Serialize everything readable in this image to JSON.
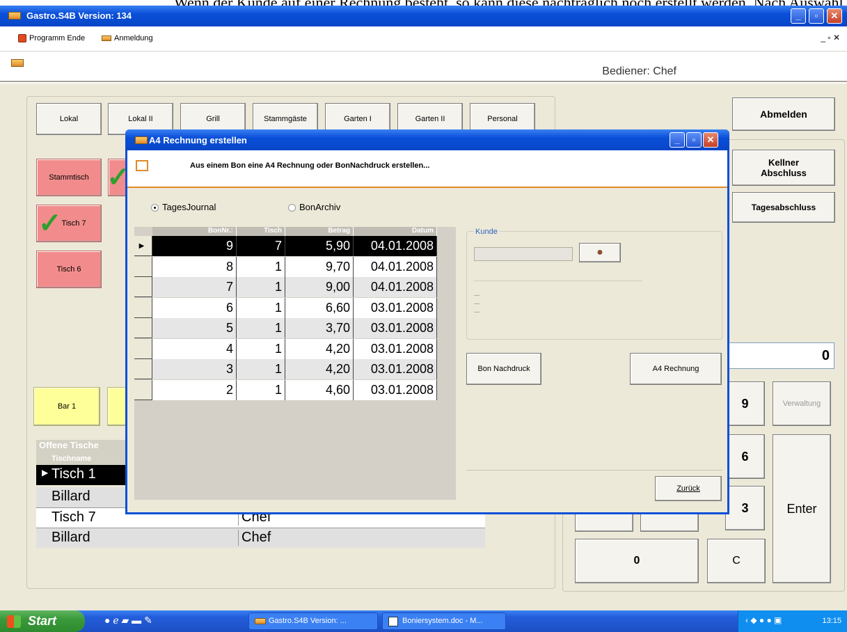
{
  "top_caption": "Wenn der Kunde auf einer Rechnung besteht, so kann diese nachträglich noch erstellt werden. Nach Auswahl des Bons über",
  "window": {
    "title": "Gastro.S4B Version:  134"
  },
  "menu": {
    "items": [
      "Programm Ende",
      "Anmeldung"
    ]
  },
  "header": {
    "bediener": "Bediener: Chef"
  },
  "room_tabs": [
    "Lokal",
    "Lokal II",
    "Grill",
    "Stammgäste",
    "Garten I",
    "Garten II",
    "Personal"
  ],
  "tables": {
    "stammtisch": "Stammtisch",
    "tisch7": "Tisch 7",
    "tisch6": "Tisch 6",
    "bar1": "Bar 1"
  },
  "right_buttons": {
    "abmelden": "Abmelden",
    "kellner": "Kellner Abschluss",
    "tages": "Tagesabschluss"
  },
  "open_tables": {
    "title": "Offene Tische",
    "col": "Tischname",
    "rows": [
      {
        "name": "Tisch  1",
        "waiter": ""
      },
      {
        "name": "Billard",
        "waiter": ""
      },
      {
        "name": "Tisch 7",
        "waiter": "Chef"
      },
      {
        "name": "Billard",
        "waiter": "Chef"
      }
    ]
  },
  "numpad": {
    "display": "0",
    "k9": "9",
    "k6": "6",
    "k3": "3",
    "k0": "0",
    "kc": "C",
    "enter": "Enter",
    "verwaltung": "Verwaltung"
  },
  "dialog": {
    "title": "A4 Rechnung erstellen",
    "subtitle": "Aus einem Bon eine A4 Rechnung oder BonNachdruck erstellen...",
    "radio_journal": "TagesJournal",
    "radio_archiv": "BonArchiv",
    "columns": [
      "BonNr.:",
      "Tisch",
      "Betrag",
      "Datum"
    ],
    "rows": [
      {
        "bon": "9",
        "tisch": "7",
        "betrag": "5,90",
        "datum": "04.01.2008"
      },
      {
        "bon": "8",
        "tisch": "1",
        "betrag": "9,70",
        "datum": "04.01.2008"
      },
      {
        "bon": "7",
        "tisch": "1",
        "betrag": "9,00",
        "datum": "04.01.2008"
      },
      {
        "bon": "6",
        "tisch": "1",
        "betrag": "6,60",
        "datum": "03.01.2008"
      },
      {
        "bon": "5",
        "tisch": "1",
        "betrag": "3,70",
        "datum": "03.01.2008"
      },
      {
        "bon": "4",
        "tisch": "1",
        "betrag": "4,20",
        "datum": "03.01.2008"
      },
      {
        "bon": "3",
        "tisch": "1",
        "betrag": "4,20",
        "datum": "03.01.2008"
      },
      {
        "bon": "2",
        "tisch": "1",
        "betrag": "4,60",
        "datum": "03.01.2008"
      }
    ],
    "kunde_label": "Kunde",
    "dots": [
      "...",
      "...",
      "..."
    ],
    "bon_nachdruck": "Bon Nachdruck",
    "a4_rechnung": "A4 Rechnung",
    "zurueck": "Zurück"
  },
  "taskbar": {
    "start": "Start",
    "tasks": [
      "Gastro.S4B Version: ...",
      "Boniersystem.doc - M..."
    ],
    "clock": "13:15"
  }
}
